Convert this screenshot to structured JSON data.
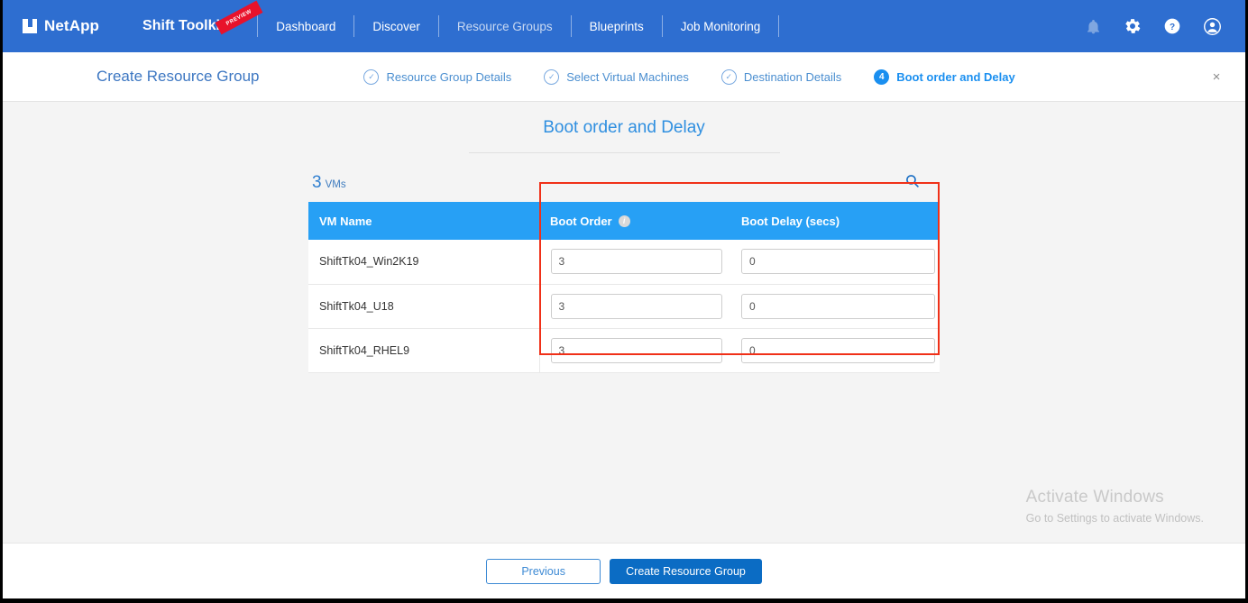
{
  "header": {
    "brand": "NetApp",
    "product": "Shift Toolkit",
    "ribbon": "PREVIEW",
    "nav": [
      {
        "label": "Dashboard",
        "dim": false
      },
      {
        "label": "Discover",
        "dim": false
      },
      {
        "label": "Resource Groups",
        "dim": true
      },
      {
        "label": "Blueprints",
        "dim": false
      },
      {
        "label": "Job Monitoring",
        "dim": false
      }
    ],
    "icons": [
      {
        "name": "notification-bell-icon"
      },
      {
        "name": "settings-gear-icon"
      },
      {
        "name": "help-question-icon"
      },
      {
        "name": "user-account-icon"
      }
    ]
  },
  "wizard": {
    "title": "Create Resource Group",
    "close_label": "×",
    "steps": [
      {
        "label": "Resource Group Details",
        "state": "done",
        "marker": "✓"
      },
      {
        "label": "Select Virtual Machines",
        "state": "done",
        "marker": "✓"
      },
      {
        "label": "Destination Details",
        "state": "done",
        "marker": "✓"
      },
      {
        "label": "Boot order and Delay",
        "state": "active",
        "marker": "4"
      }
    ]
  },
  "main": {
    "page_title": "Boot order and Delay",
    "count_value": "3",
    "count_label": "VMs",
    "search_icon": "search-icon",
    "table": {
      "columns": [
        {
          "key": "vm_name",
          "label": "VM Name",
          "info": false
        },
        {
          "key": "boot_order",
          "label": "Boot Order",
          "info": true
        },
        {
          "key": "boot_delay",
          "label": "Boot Delay (secs)",
          "info": false
        }
      ],
      "rows": [
        {
          "vm_name": "ShiftTk04_Win2K19",
          "boot_order": "3",
          "boot_delay": "0"
        },
        {
          "vm_name": "ShiftTk04_U18",
          "boot_order": "3",
          "boot_delay": "0"
        },
        {
          "vm_name": "ShiftTk04_RHEL9",
          "boot_order": "3",
          "boot_delay": "0"
        }
      ]
    },
    "annotation_color": "#f03018"
  },
  "watermark": {
    "line1": "Activate Windows",
    "line2": "Go to Settings to activate Windows."
  },
  "footer": {
    "previous_label": "Previous",
    "create_label": "Create Resource Group"
  },
  "colors": {
    "nav_blue": "#2e6ed0",
    "table_header_blue": "#27a0f5",
    "accent_blue": "#1a8ff0",
    "primary_button": "#0b6cc4",
    "annotation_red": "#f03018"
  }
}
